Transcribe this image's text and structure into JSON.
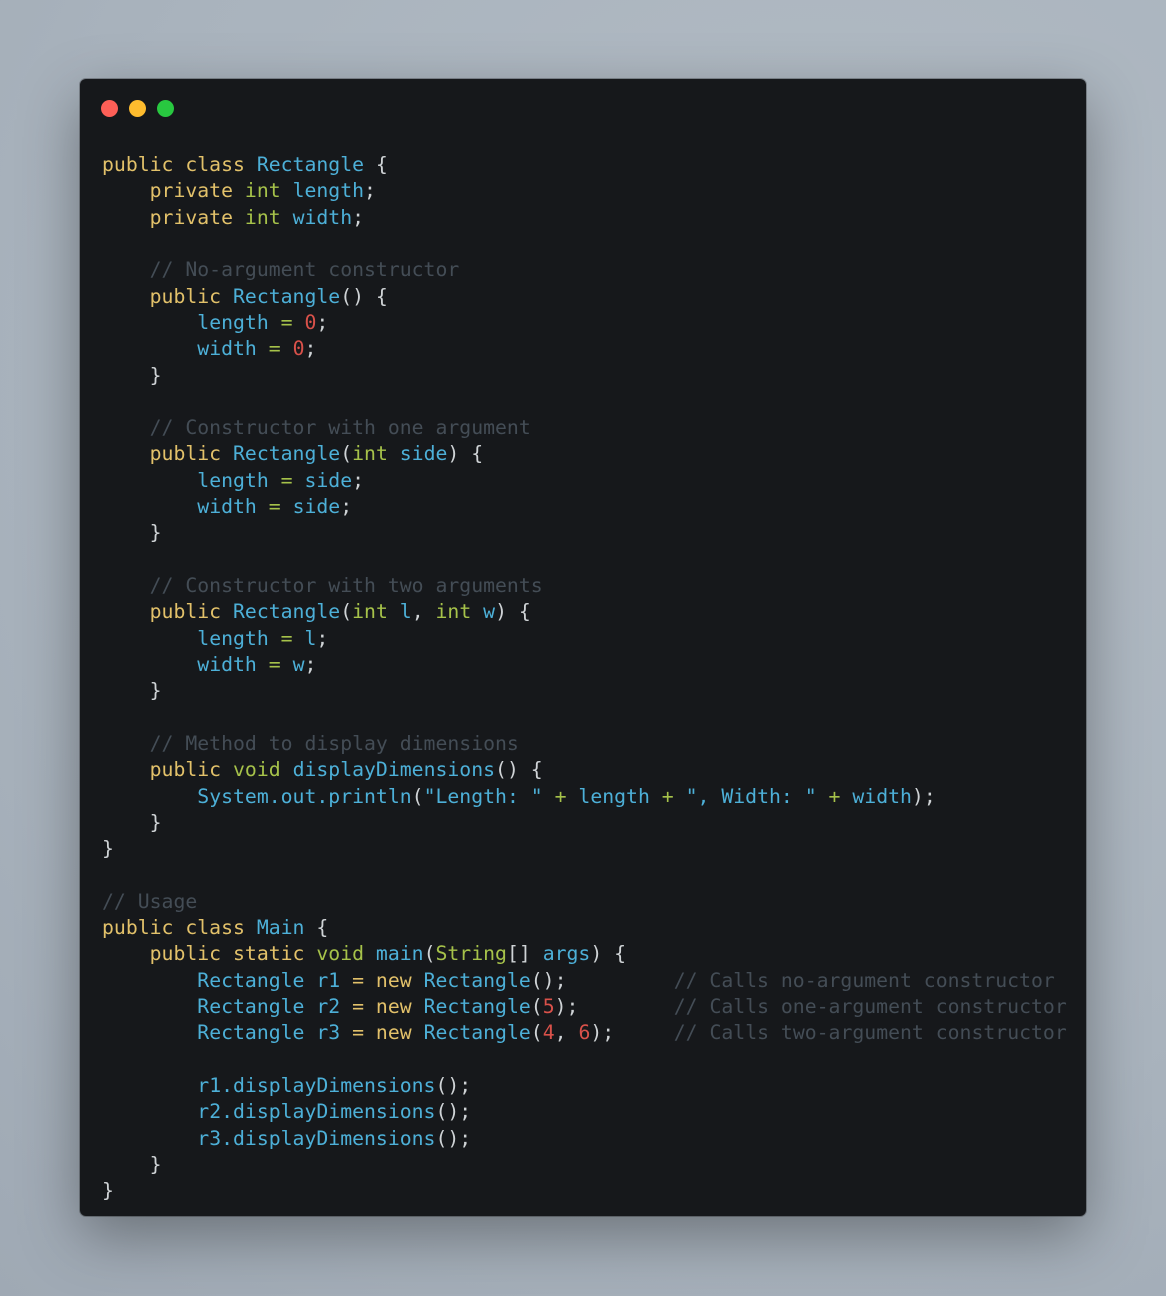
{
  "window": {
    "controls": {
      "close_color": "#fe5f57",
      "minimize_color": "#febc2e",
      "maximize_color": "#28c840"
    }
  },
  "theme": {
    "keyword": "#e2c16a",
    "type": "#a6c24a",
    "identifier": "#4db0d8",
    "number": "#d9514a",
    "comment": "#444d56",
    "punctuation": "#cfd3d6",
    "background": "#16181b"
  },
  "code": {
    "language": "java",
    "lines": [
      [
        [
          "kw",
          "public class "
        ],
        [
          "id",
          "Rectangle"
        ],
        [
          "pn",
          " {"
        ]
      ],
      [
        [
          "pn",
          "    "
        ],
        [
          "kw",
          "private "
        ],
        [
          "ty",
          "int "
        ],
        [
          "id",
          "length"
        ],
        [
          "pn",
          ";"
        ]
      ],
      [
        [
          "pn",
          "    "
        ],
        [
          "kw",
          "private "
        ],
        [
          "ty",
          "int "
        ],
        [
          "id",
          "width"
        ],
        [
          "pn",
          ";"
        ]
      ],
      [],
      [
        [
          "pn",
          "    "
        ],
        [
          "cm",
          "// No-argument constructor"
        ]
      ],
      [
        [
          "pn",
          "    "
        ],
        [
          "kw",
          "public "
        ],
        [
          "id",
          "Rectangle"
        ],
        [
          "pn",
          "() {"
        ]
      ],
      [
        [
          "pn",
          "        "
        ],
        [
          "id",
          "length "
        ],
        [
          "op",
          "= "
        ],
        [
          "num",
          "0"
        ],
        [
          "pn",
          ";"
        ]
      ],
      [
        [
          "pn",
          "        "
        ],
        [
          "id",
          "width "
        ],
        [
          "op",
          "= "
        ],
        [
          "num",
          "0"
        ],
        [
          "pn",
          ";"
        ]
      ],
      [
        [
          "pn",
          "    }"
        ]
      ],
      [],
      [
        [
          "pn",
          "    "
        ],
        [
          "cm",
          "// Constructor with one argument"
        ]
      ],
      [
        [
          "pn",
          "    "
        ],
        [
          "kw",
          "public "
        ],
        [
          "id",
          "Rectangle"
        ],
        [
          "pn",
          "("
        ],
        [
          "ty",
          "int "
        ],
        [
          "id",
          "side"
        ],
        [
          "pn",
          ") {"
        ]
      ],
      [
        [
          "pn",
          "        "
        ],
        [
          "id",
          "length "
        ],
        [
          "op",
          "= "
        ],
        [
          "id",
          "side"
        ],
        [
          "pn",
          ";"
        ]
      ],
      [
        [
          "pn",
          "        "
        ],
        [
          "id",
          "width "
        ],
        [
          "op",
          "= "
        ],
        [
          "id",
          "side"
        ],
        [
          "pn",
          ";"
        ]
      ],
      [
        [
          "pn",
          "    }"
        ]
      ],
      [],
      [
        [
          "pn",
          "    "
        ],
        [
          "cm",
          "// Constructor with two arguments"
        ]
      ],
      [
        [
          "pn",
          "    "
        ],
        [
          "kw",
          "public "
        ],
        [
          "id",
          "Rectangle"
        ],
        [
          "pn",
          "("
        ],
        [
          "ty",
          "int "
        ],
        [
          "id",
          "l"
        ],
        [
          "pn",
          ", "
        ],
        [
          "ty",
          "int "
        ],
        [
          "id",
          "w"
        ],
        [
          "pn",
          ") {"
        ]
      ],
      [
        [
          "pn",
          "        "
        ],
        [
          "id",
          "length "
        ],
        [
          "op",
          "= "
        ],
        [
          "id",
          "l"
        ],
        [
          "pn",
          ";"
        ]
      ],
      [
        [
          "pn",
          "        "
        ],
        [
          "id",
          "width "
        ],
        [
          "op",
          "= "
        ],
        [
          "id",
          "w"
        ],
        [
          "pn",
          ";"
        ]
      ],
      [
        [
          "pn",
          "    }"
        ]
      ],
      [],
      [
        [
          "pn",
          "    "
        ],
        [
          "cm",
          "// Method to display dimensions"
        ]
      ],
      [
        [
          "pn",
          "    "
        ],
        [
          "kw",
          "public "
        ],
        [
          "ty",
          "void "
        ],
        [
          "id",
          "displayDimensions"
        ],
        [
          "pn",
          "() {"
        ]
      ],
      [
        [
          "pn",
          "        "
        ],
        [
          "id",
          "System.out.println"
        ],
        [
          "pn",
          "("
        ],
        [
          "id",
          "\"Length: \" "
        ],
        [
          "op",
          "+ "
        ],
        [
          "id",
          "length "
        ],
        [
          "op",
          "+ "
        ],
        [
          "id",
          "\", Width: \" "
        ],
        [
          "op",
          "+ "
        ],
        [
          "id",
          "width"
        ],
        [
          "pn",
          ");"
        ]
      ],
      [
        [
          "pn",
          "    }"
        ]
      ],
      [
        [
          "pn",
          "}"
        ]
      ],
      [],
      [
        [
          "cm",
          "// Usage"
        ]
      ],
      [
        [
          "kw",
          "public class "
        ],
        [
          "id",
          "Main"
        ],
        [
          "pn",
          " {"
        ]
      ],
      [
        [
          "pn",
          "    "
        ],
        [
          "kw",
          "public static "
        ],
        [
          "ty",
          "void "
        ],
        [
          "id",
          "main"
        ],
        [
          "pn",
          "("
        ],
        [
          "ty",
          "String"
        ],
        [
          "pn",
          "[] "
        ],
        [
          "id",
          "args"
        ],
        [
          "pn",
          ") {"
        ]
      ],
      [
        [
          "pn",
          "        "
        ],
        [
          "id",
          "Rectangle r1 "
        ],
        [
          "op2",
          "= new "
        ],
        [
          "id",
          "Rectangle"
        ],
        [
          "pn",
          "();"
        ],
        [
          "pn",
          "         "
        ],
        [
          "cm",
          "// Calls no-argument constructor"
        ]
      ],
      [
        [
          "pn",
          "        "
        ],
        [
          "id",
          "Rectangle r2 "
        ],
        [
          "op2",
          "= new "
        ],
        [
          "id",
          "Rectangle"
        ],
        [
          "pn",
          "("
        ],
        [
          "num",
          "5"
        ],
        [
          "pn",
          ");"
        ],
        [
          "pn",
          "        "
        ],
        [
          "cm",
          "// Calls one-argument constructor"
        ]
      ],
      [
        [
          "pn",
          "        "
        ],
        [
          "id",
          "Rectangle r3 "
        ],
        [
          "op2",
          "= new "
        ],
        [
          "id",
          "Rectangle"
        ],
        [
          "pn",
          "("
        ],
        [
          "num",
          "4"
        ],
        [
          "pn",
          ", "
        ],
        [
          "num",
          "6"
        ],
        [
          "pn",
          ");"
        ],
        [
          "pn",
          "     "
        ],
        [
          "cm",
          "// Calls two-argument constructor"
        ]
      ],
      [],
      [
        [
          "pn",
          "        "
        ],
        [
          "id",
          "r1.displayDimensions"
        ],
        [
          "pn",
          "();"
        ]
      ],
      [
        [
          "pn",
          "        "
        ],
        [
          "id",
          "r2.displayDimensions"
        ],
        [
          "pn",
          "();"
        ]
      ],
      [
        [
          "pn",
          "        "
        ],
        [
          "id",
          "r3.displayDimensions"
        ],
        [
          "pn",
          "();"
        ]
      ],
      [
        [
          "pn",
          "    }"
        ]
      ],
      [
        [
          "pn",
          "}"
        ]
      ]
    ]
  }
}
